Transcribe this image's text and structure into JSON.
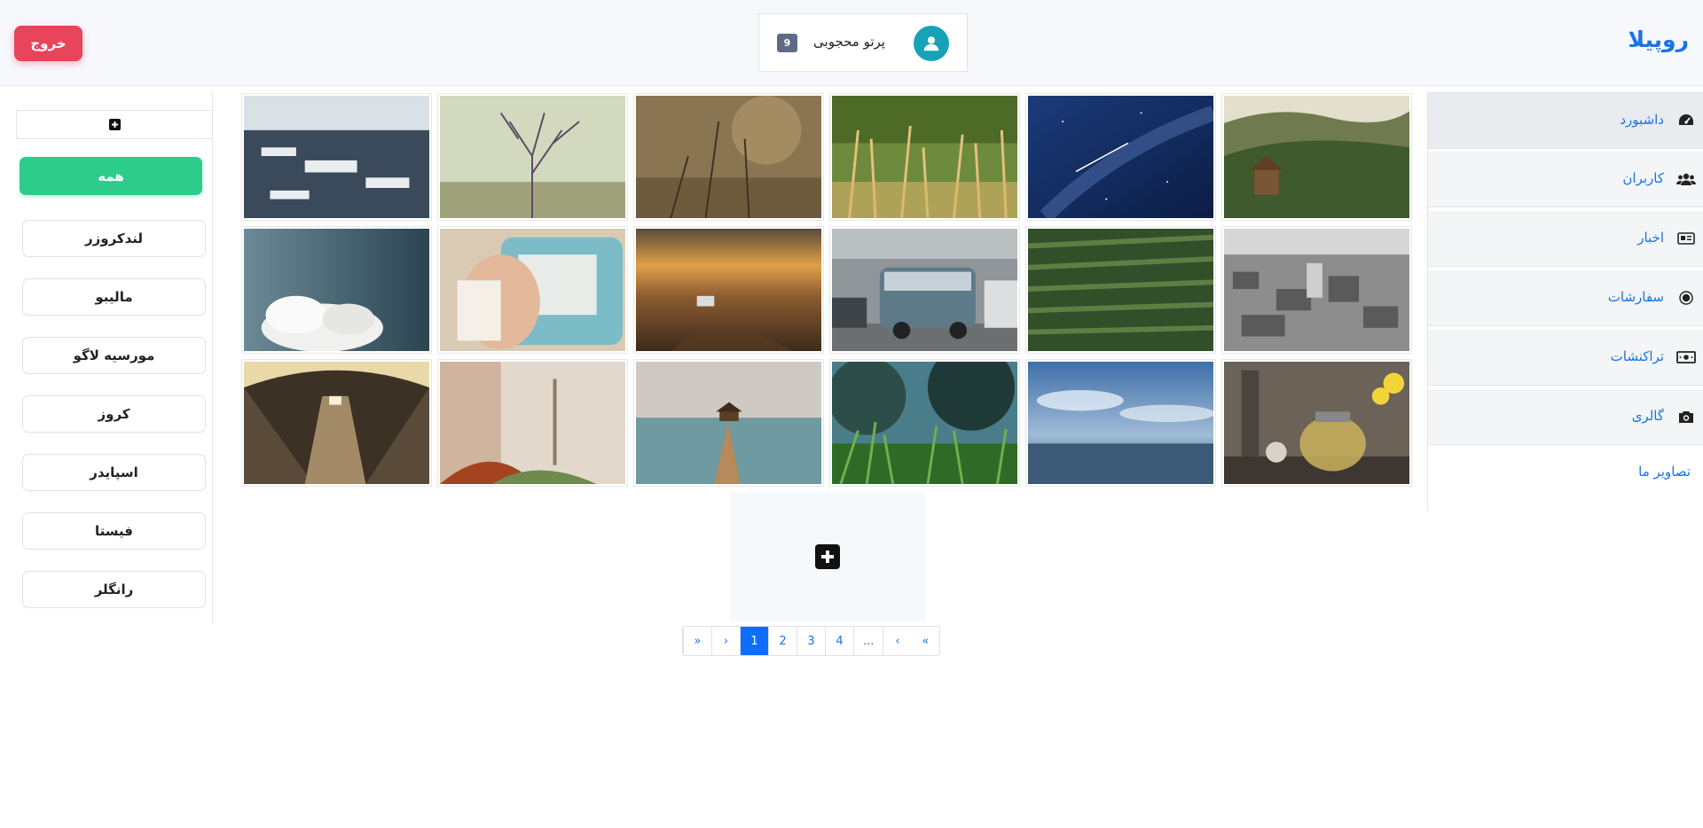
{
  "header": {
    "brand": "روپیلا",
    "logout_label": "خروج",
    "user_name": "پرتو محجوبی",
    "notification_count": "9"
  },
  "sidebar": {
    "items": [
      {
        "label": "داشبورد",
        "icon": "dashboard-gauge-icon",
        "active": true
      },
      {
        "label": "کاربران",
        "icon": "users-icon",
        "active": false
      },
      {
        "label": "اخبار",
        "icon": "newspaper-icon",
        "active": false
      },
      {
        "label": "سفارشات",
        "icon": "record-circle-icon",
        "active": false
      },
      {
        "label": "تراکنشات",
        "icon": "money-bill-icon",
        "active": false
      },
      {
        "label": "گالری",
        "icon": "camera-icon",
        "active": false
      }
    ],
    "sub_item": "تصاویر ما"
  },
  "filters": {
    "add_icon": "plus-square-icon",
    "all_label": "همه",
    "categories": [
      "لندکروزر",
      "مالیبو",
      "مورسیه لاگو",
      "کروز",
      "اسپایدر",
      "فیستا",
      "رانگلر"
    ]
  },
  "gallery": {
    "photos": [
      {
        "subject": "hillside-cabin"
      },
      {
        "subject": "starry-sky"
      },
      {
        "subject": "golden-grass"
      },
      {
        "subject": "wheat-field"
      },
      {
        "subject": "bare-tree"
      },
      {
        "subject": "snowy-rooftops"
      },
      {
        "subject": "bw-city-aerial"
      },
      {
        "subject": "tea-plantation"
      },
      {
        "subject": "vw-vans-street"
      },
      {
        "subject": "desert-car-sunset"
      },
      {
        "subject": "couple-in-van"
      },
      {
        "subject": "cloudy-sky"
      },
      {
        "subject": "teapot-flowers"
      },
      {
        "subject": "ocean-horizon"
      },
      {
        "subject": "grass-closeup"
      },
      {
        "subject": "pier-to-sea"
      },
      {
        "subject": "misty-forest-path"
      },
      {
        "subject": "escalator-tunnel"
      }
    ],
    "add_icon": "plus-square-icon"
  },
  "pagination": {
    "first": "«",
    "prev": "‹",
    "pages": [
      "1",
      "2",
      "3",
      "4"
    ],
    "active_page": "1",
    "ellipsis": "...",
    "next": "›",
    "last": "»"
  }
}
